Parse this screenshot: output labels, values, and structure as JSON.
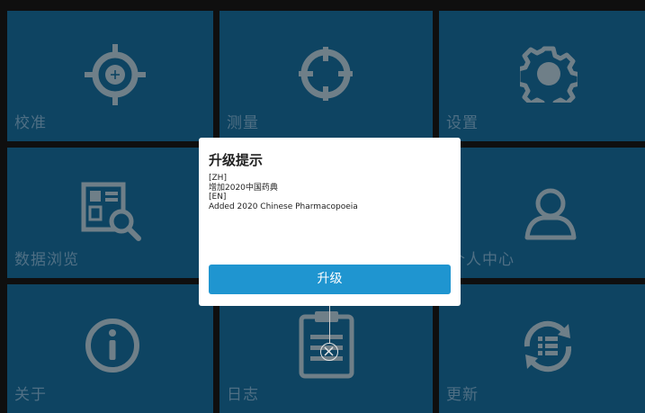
{
  "tiles": [
    {
      "label": "校准",
      "icon": "crosshair-target-icon"
    },
    {
      "label": "测量",
      "icon": "crosshair-circle-icon"
    },
    {
      "label": "设置",
      "icon": "gear-icon"
    },
    {
      "label": "数据浏览",
      "icon": "data-browse-icon"
    },
    {
      "label": "",
      "icon": ""
    },
    {
      "label": "个人中心",
      "icon": "user-icon"
    },
    {
      "label": "关于",
      "icon": "info-icon"
    },
    {
      "label": "日志",
      "icon": "clipboard-log-icon"
    },
    {
      "label": "更新",
      "icon": "update-list-icon"
    }
  ],
  "dialog": {
    "title": "升级提示",
    "lines": [
      "[ZH]",
      "增加2020中国药典",
      "[EN]",
      "Added 2020 Chinese Pharmacopoeia"
    ],
    "button_label": "升级"
  },
  "colors": {
    "tile_bg": "#0e4462",
    "icon_gray": "#6f7f88",
    "button_blue": "#1f95d0"
  }
}
